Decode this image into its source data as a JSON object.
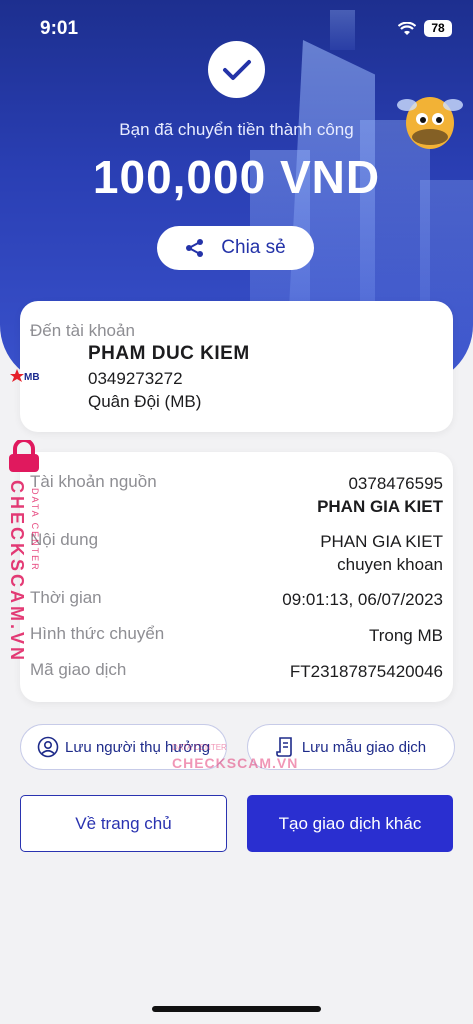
{
  "status": {
    "time": "9:01",
    "battery": "78"
  },
  "hero": {
    "success_text": "Bạn đã chuyển tiền thành công",
    "amount": "100,000 VND",
    "share_label": "Chia sẻ"
  },
  "recipient": {
    "label": "Đến tài khoản",
    "bank_logo": "MB",
    "name": "PHAM DUC KIEM",
    "account_number": "0349273272",
    "bank": "Quân Đội (MB)"
  },
  "details": {
    "source": {
      "label": "Tài khoản nguồn",
      "account": "0378476595",
      "name": "PHAN GIA KIET"
    },
    "content": {
      "label": "Nội dung",
      "line1": "PHAN GIA KIET",
      "line2": "chuyen khoan"
    },
    "time": {
      "label": "Thời gian",
      "value": "09:01:13, 06/07/2023"
    },
    "method": {
      "label": "Hình thức chuyển",
      "value": "Trong MB"
    },
    "txn": {
      "label": "Mã giao dịch",
      "value": "FT23187875420046"
    }
  },
  "actions": {
    "save_beneficiary": "Lưu người thụ hưởng",
    "save_template": "Lưu mẫu giao dịch",
    "home": "Về trang chủ",
    "new_transaction": "Tạo giao dịch khác"
  },
  "watermark": {
    "brand": "CHECKSCAM.VN",
    "sub": "DATA CENTER",
    "center": "CHECKSCAM.VN",
    "center_sub": "DATA CENTER"
  },
  "colors": {
    "primary": "#2a2fd0",
    "hero": "#2a3fb4",
    "watermark": "#e0195e"
  },
  "icons": [
    "check-icon",
    "share-icon",
    "wifi-icon",
    "mb-bank-logo",
    "user-circle-icon",
    "document-icon",
    "lock-icon"
  ]
}
